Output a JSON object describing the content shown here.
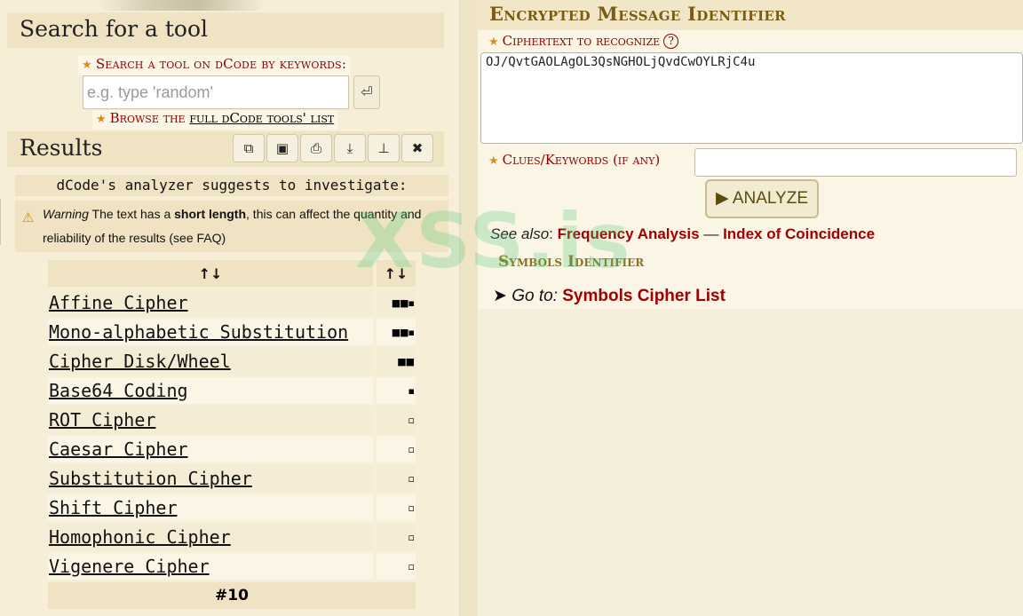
{
  "search": {
    "title": "Search for a tool",
    "label": "Search a tool on dCode by keywords:",
    "placeholder": "e.g. type 'random'",
    "go_icon": "enter-icon",
    "browse_prefix": "Browse the ",
    "browse_link": "full dCode tools' list"
  },
  "results": {
    "title": "Results",
    "toolbar": [
      {
        "name": "copy-icon",
        "glyph": "⧉"
      },
      {
        "name": "save-icon",
        "glyph": "▣"
      },
      {
        "name": "print-icon",
        "glyph": "⎙"
      },
      {
        "name": "download-icon",
        "glyph": "⤓"
      },
      {
        "name": "pin-icon",
        "glyph": "📌"
      },
      {
        "name": "close-icon",
        "glyph": "✖"
      }
    ],
    "suggest": "dCode's analyzer suggests to investigate:",
    "warning_word": "Warning",
    "warning_pre": " The text has a ",
    "warning_bold": "short length",
    "warning_post": ", this can affect the quantity and reliability of the results (see FAQ)",
    "header_sort1": "↑↓",
    "header_sort2": "↑↓",
    "rows": [
      {
        "name": "Affine Cipher",
        "score": "■■▪"
      },
      {
        "name": "Mono-alphabetic Substitution",
        "score": "■■▪"
      },
      {
        "name": "Cipher Disk/Wheel",
        "score": "■■"
      },
      {
        "name": "Base64 Coding",
        "score": "▪"
      },
      {
        "name": "ROT Cipher",
        "score": "▫"
      },
      {
        "name": "Caesar Cipher",
        "score": "▫"
      },
      {
        "name": "Substitution Cipher",
        "score": "▫"
      },
      {
        "name": "Shift Cipher",
        "score": "▫"
      },
      {
        "name": "Homophonic Cipher",
        "score": "▫"
      },
      {
        "name": "Vigenere Cipher",
        "score": "▫"
      }
    ],
    "footer": "#10"
  },
  "tool": {
    "title": "Encrypted Message Identifier",
    "cipher_label": "Ciphertext to recognize",
    "help": "?",
    "cipher_value": "OJ/QvtGAOLAgOL3QsNGHOLjQvdCwOYLRjC4u",
    "clues_label": "Clues/Keywords (if any)",
    "clues_value": "",
    "analyze": "▶ ANALYZE",
    "see_also_label": "See also",
    "see_also_link1": "Frequency Analysis",
    "see_also_sep": " — ",
    "see_also_link2": "Index of Coincidence",
    "symbols_title": "Symbols Identifier",
    "goto_label": "Go to:",
    "goto_link": "Symbols Cipher List"
  },
  "watermark": "XSS.is"
}
